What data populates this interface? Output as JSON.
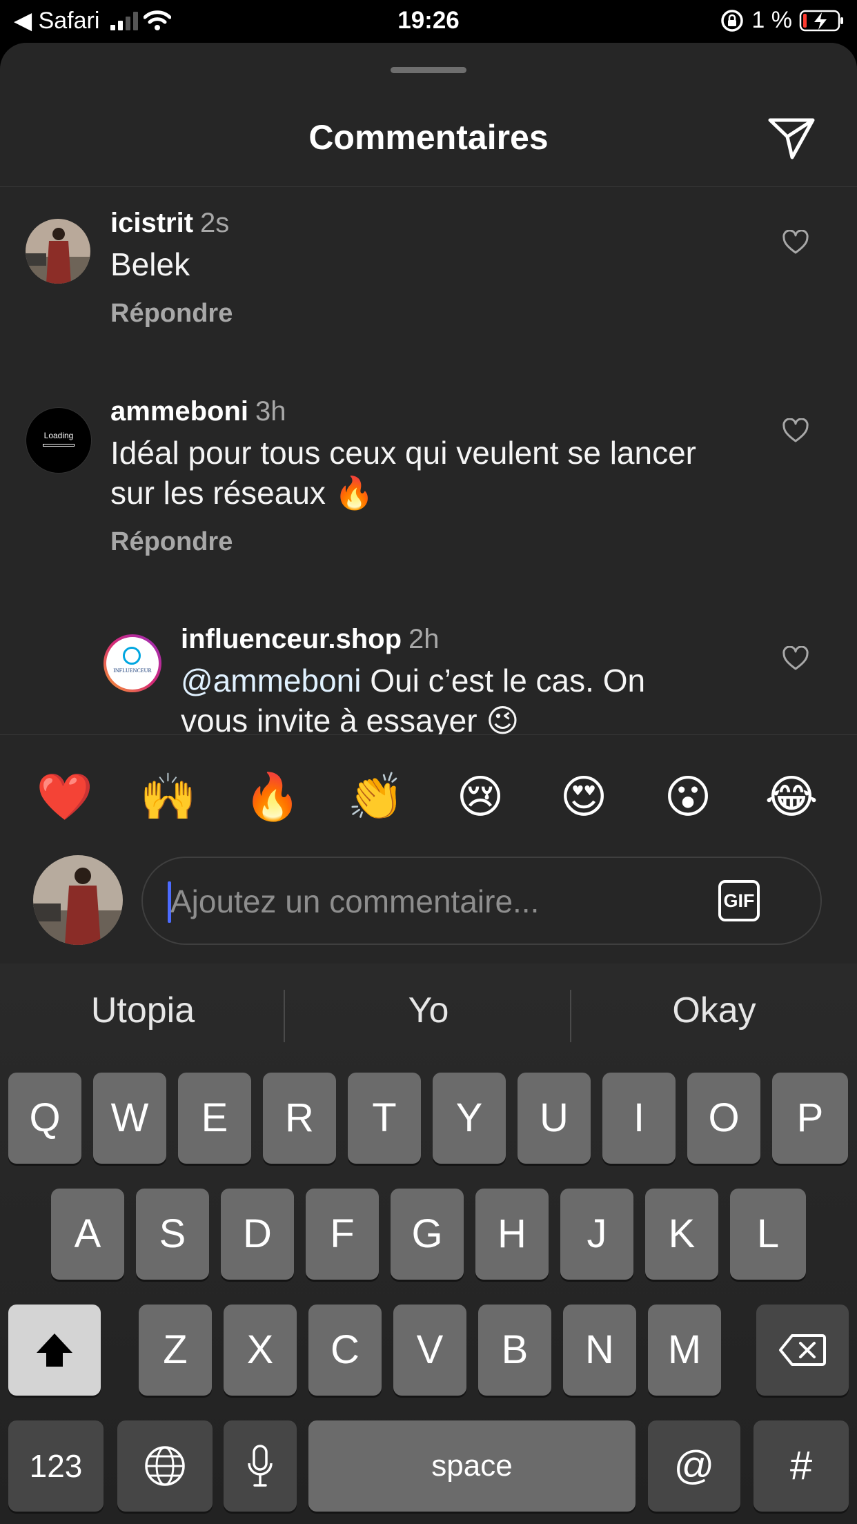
{
  "status_bar": {
    "back_app": "◀ Safari",
    "time": "19:26",
    "battery": "1 %"
  },
  "sheet": {
    "title": "Commentaires"
  },
  "comments": [
    {
      "user": "icistrit",
      "time": "2s",
      "text": "Belek",
      "reply": "Répondre"
    },
    {
      "user": "ammeboni",
      "time": "3h",
      "text_line1": "Idéal pour tous ceux qui veulent se lancer",
      "text_line2": "sur les réseaux 🔥",
      "reply": "Répondre",
      "avatar_text": "Loading"
    },
    {
      "user": "influenceur.shop",
      "time": "2h",
      "mention": "@ammeboni",
      "text_line1": " Oui c’est le cas. On",
      "text_line2": "vous invite à essayer 😉",
      "avatar_text": "INFLUENCEUR"
    }
  ],
  "emoji_bar": [
    "❤️",
    "🙌",
    "🔥",
    "👏",
    "😢",
    "😍",
    "😮",
    "😂"
  ],
  "input": {
    "placeholder": "Ajoutez un commentaire...",
    "gif_label": "GIF"
  },
  "keyboard": {
    "suggestions": [
      "Utopia",
      "Yo",
      "Okay"
    ],
    "row1": [
      "Q",
      "W",
      "E",
      "R",
      "T",
      "Y",
      "U",
      "I",
      "O",
      "P"
    ],
    "row2": [
      "A",
      "S",
      "D",
      "F",
      "G",
      "H",
      "J",
      "K",
      "L"
    ],
    "row3": [
      "Z",
      "X",
      "C",
      "V",
      "B",
      "N",
      "M"
    ],
    "numbers_key": "123",
    "space_key": "space",
    "at_key": "@",
    "hash_key": "#"
  },
  "icons": [
    "send-icon",
    "heart-icon",
    "shift-icon",
    "backspace-icon",
    "globe-icon",
    "microphone-icon",
    "wifi-icon",
    "orientation-lock-icon",
    "battery-icon"
  ]
}
